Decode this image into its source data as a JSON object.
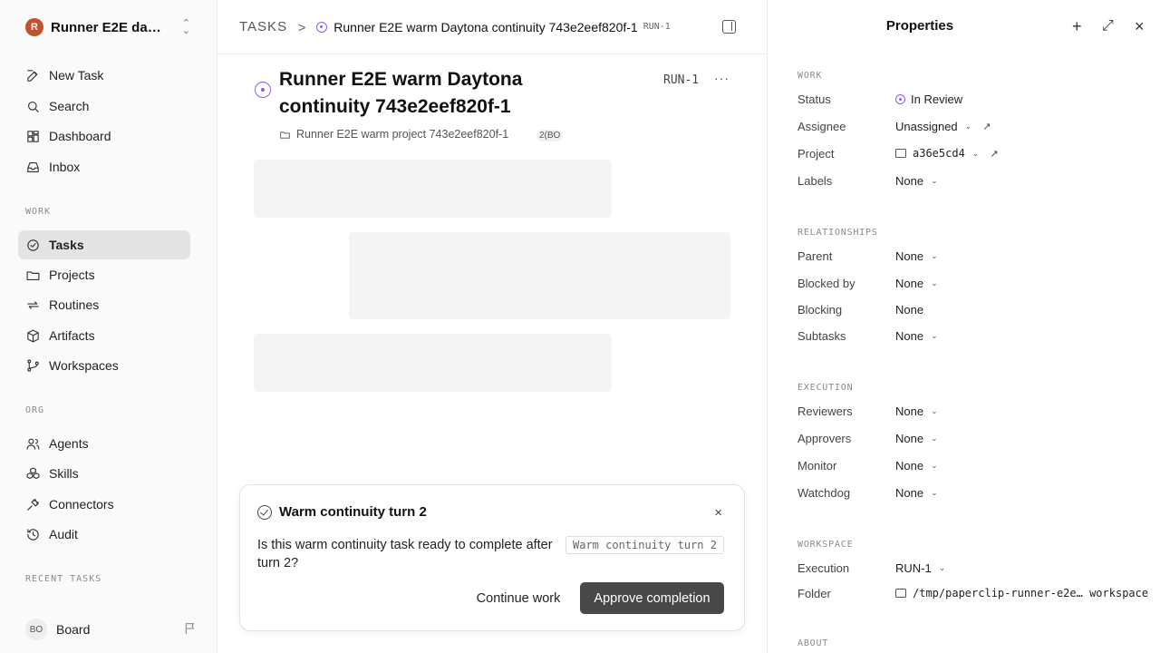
{
  "sidebar": {
    "workspace": {
      "initial": "R",
      "name": "Runner E2E dayt..."
    },
    "nav_top": [
      {
        "label": "New Task"
      },
      {
        "label": "Search"
      },
      {
        "label": "Dashboard"
      },
      {
        "label": "Inbox"
      }
    ],
    "section_work": "WORK",
    "nav_work": [
      {
        "label": "Tasks"
      },
      {
        "label": "Projects"
      },
      {
        "label": "Routines"
      },
      {
        "label": "Artifacts"
      },
      {
        "label": "Workspaces"
      }
    ],
    "section_org": "ORG",
    "nav_org": [
      {
        "label": "Agents"
      },
      {
        "label": "Skills"
      },
      {
        "label": "Connectors"
      },
      {
        "label": "Audit"
      }
    ],
    "section_recent": "RECENT TASKS",
    "board": {
      "initials": "BO",
      "label": "Board"
    }
  },
  "header": {
    "root": "TASKS",
    "separator": ">",
    "task_title": "Runner E2E warm Daytona continuity 743e2eef820f-1",
    "task_id": "RUN-1"
  },
  "task": {
    "title": "Runner E2E warm Daytona continuity 743e2eef820f-1",
    "id": "RUN-1",
    "more": "···",
    "project": "Runner E2E warm project 743e2eef820f-1",
    "badge": "2(BO"
  },
  "interaction": {
    "title": "Warm continuity turn 2",
    "close": "×",
    "question": "Is this warm continuity task ready to complete after turn 2?",
    "tag": "Warm continuity turn 2",
    "continue_label": "Continue work",
    "approve_label": "Approve completion"
  },
  "properties": {
    "title": "Properties",
    "add": "+",
    "expand": "⤢",
    "close": "×",
    "work": {
      "heading": "WORK",
      "status_key": "Status",
      "status_val": "In Review",
      "assignee_key": "Assignee",
      "assignee_val": "Unassigned",
      "project_key": "Project",
      "project_val": "a36e5cd4",
      "labels_key": "Labels",
      "labels_val": "None"
    },
    "relationships": {
      "heading": "RELATIONSHIPS",
      "parent_key": "Parent",
      "parent_val": "None",
      "blocked_by_key": "Blocked by",
      "blocked_by_val": "None",
      "blocking_key": "Blocking",
      "blocking_val": "None",
      "subtasks_key": "Subtasks",
      "subtasks_val": "None"
    },
    "execution": {
      "heading": "EXECUTION",
      "reviewers_key": "Reviewers",
      "reviewers_val": "None",
      "approvers_key": "Approvers",
      "approvers_val": "None",
      "monitor_key": "Monitor",
      "monitor_val": "None",
      "watchdog_key": "Watchdog",
      "watchdog_val": "None"
    },
    "workspace": {
      "heading": "WORKSPACE",
      "execution_key": "Execution",
      "execution_val": "RUN-1",
      "folder_key": "Folder",
      "folder_val": "/tmp/paperclip-runner-e2e… workspace"
    },
    "about": {
      "heading": "ABOUT"
    }
  },
  "icons": {
    "status_color": "#8b5cf6",
    "primary_button_color": "#484848",
    "workspace_logo_color": "#c0532b"
  }
}
